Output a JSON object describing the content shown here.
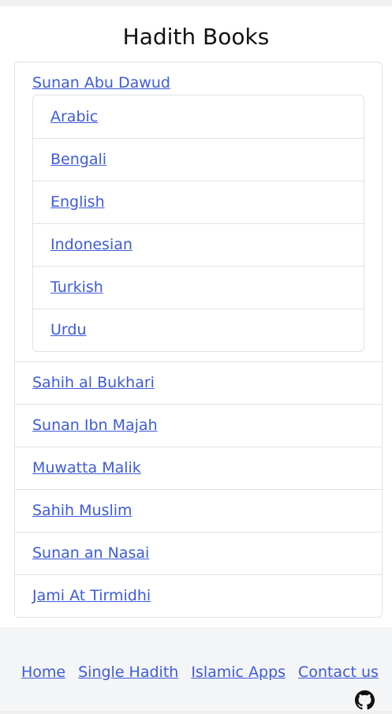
{
  "page_title": "Hadith Books",
  "books": [
    {
      "name": "Sunan Abu Dawud",
      "languages": [
        "Arabic",
        "Bengali",
        "English",
        "Indonesian",
        "Turkish",
        "Urdu"
      ]
    },
    {
      "name": "Sahih al Bukhari"
    },
    {
      "name": "Sunan Ibn Majah"
    },
    {
      "name": "Muwatta Malik"
    },
    {
      "name": "Sahih Muslim"
    },
    {
      "name": "Sunan an Nasai"
    },
    {
      "name": "Jami At Tirmidhi"
    }
  ],
  "footer": {
    "links": [
      "Home",
      "Single Hadith",
      "Islamic Apps",
      "Contact us"
    ],
    "github_icon": "github-icon"
  },
  "colors": {
    "link": "#3d5bd9",
    "border": "#dfe2e6",
    "footer_bg": "#f4f5f7"
  }
}
